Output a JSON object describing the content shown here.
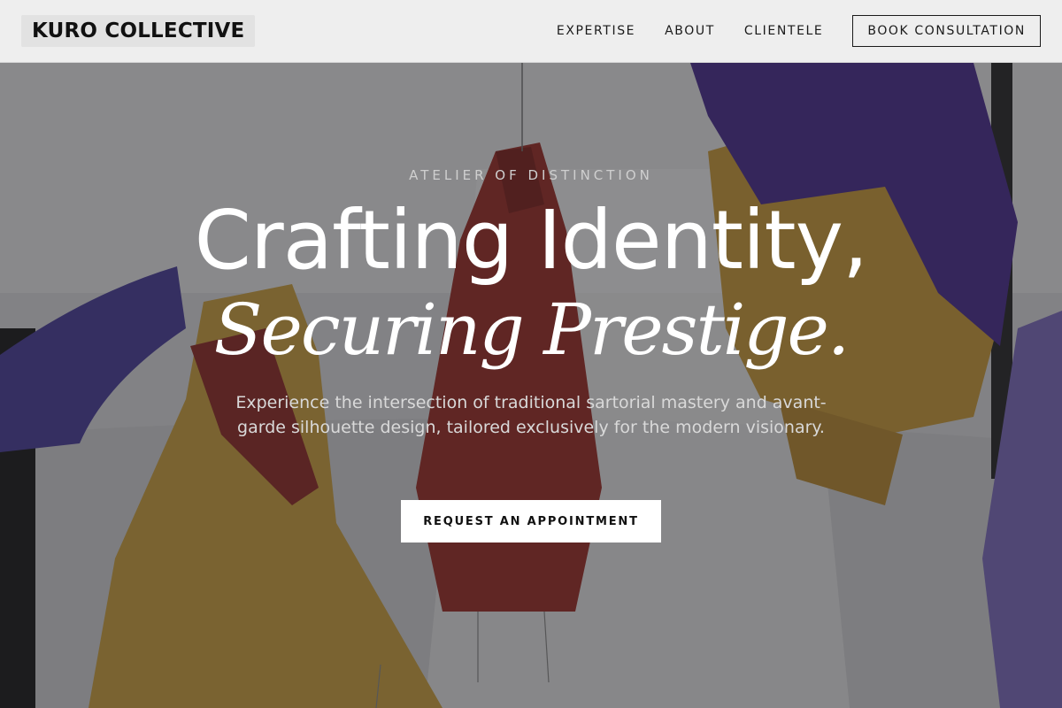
{
  "brand": {
    "name": "KURO COLLECTIVE"
  },
  "nav": {
    "links": [
      "EXPERTISE",
      "ABOUT",
      "CLIENTELE"
    ],
    "cta": "BOOK CONSULTATION"
  },
  "hero": {
    "eyebrow": "ATELIER OF DISTINCTION",
    "headline_line1": "Crafting Identity,",
    "headline_line2": "Securing Prestige.",
    "description": "Experience the intersection of traditional sartorial mastery and avant-garde silhouette design, tailored exclusively for the modern visionary.",
    "cta": "REQUEST AN APPOINTMENT",
    "background_image": "hanging colorful jackets in a white gallery space",
    "colors": {
      "overlay": "#1c1c1e",
      "jacket_red": "#9a2f2a",
      "jacket_mustard": "#c79a3c",
      "jacket_purple": "#4b2f8f"
    }
  }
}
